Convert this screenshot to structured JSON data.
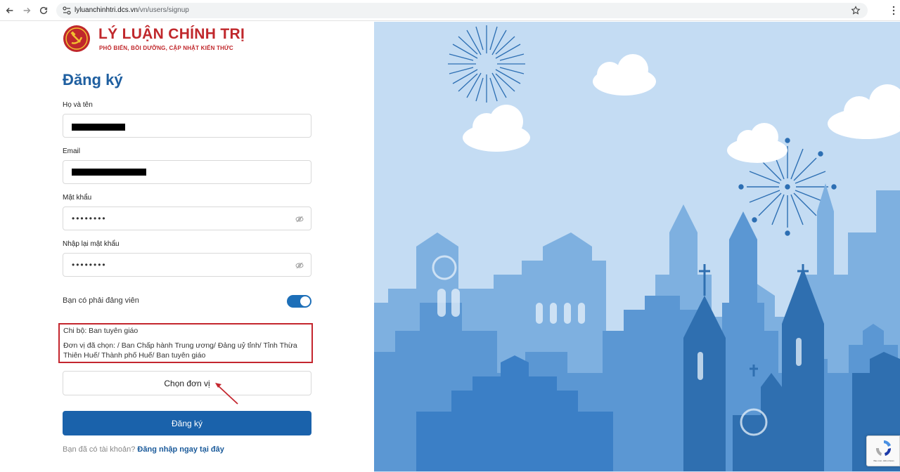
{
  "browser": {
    "url_host": "lyluanchinhtri.dcs.vn",
    "url_path": "/vn/users/signup"
  },
  "logo": {
    "title": "LÝ LUẬN CHÍNH TRỊ",
    "subtitle": "PHỔ BIẾN, BỒI DƯỠNG, CẬP NHẬT KIẾN THỨC"
  },
  "form": {
    "title": "Đăng ký",
    "fullname": {
      "label": "Họ và tên"
    },
    "email": {
      "label": "Email"
    },
    "password": {
      "label": "Mật khẩu",
      "value": "••••••••"
    },
    "password_confirm": {
      "label": "Nhập lại mật khẩu",
      "value": "••••••••"
    },
    "party_member": {
      "label": "Bạn có phải đảng viên",
      "checked": true
    },
    "unit": {
      "chi_bo": "Chi bộ: Ban tuyên giáo",
      "selected": "Đơn vị đã chọn: / Ban Chấp hành Trung ương/ Đảng uỷ tỉnh/ Tỉnh Thừa Thiên Huế/ Thành phố Huế/ Ban tuyên giáo"
    },
    "choose_unit_label": "Chọn đơn vị",
    "submit_label": "Đăng ký",
    "login_question": "Bạn đã có tài khoản?",
    "login_link": "Đăng nhập ngay tại đây"
  },
  "recaptcha": {
    "text": "Bảo mật - Điều khoản"
  },
  "colors": {
    "brand_red": "#c0282c",
    "primary_blue": "#1a62ab",
    "title_blue": "#1f5fa0",
    "sky": "#c4dcf3",
    "annotation_red": "#c4262e"
  },
  "icons": [
    "back-icon",
    "forward-icon",
    "reload-icon",
    "site-info-icon",
    "star-icon",
    "menu-icon",
    "eye-off-icon",
    "recaptcha-icon"
  ]
}
